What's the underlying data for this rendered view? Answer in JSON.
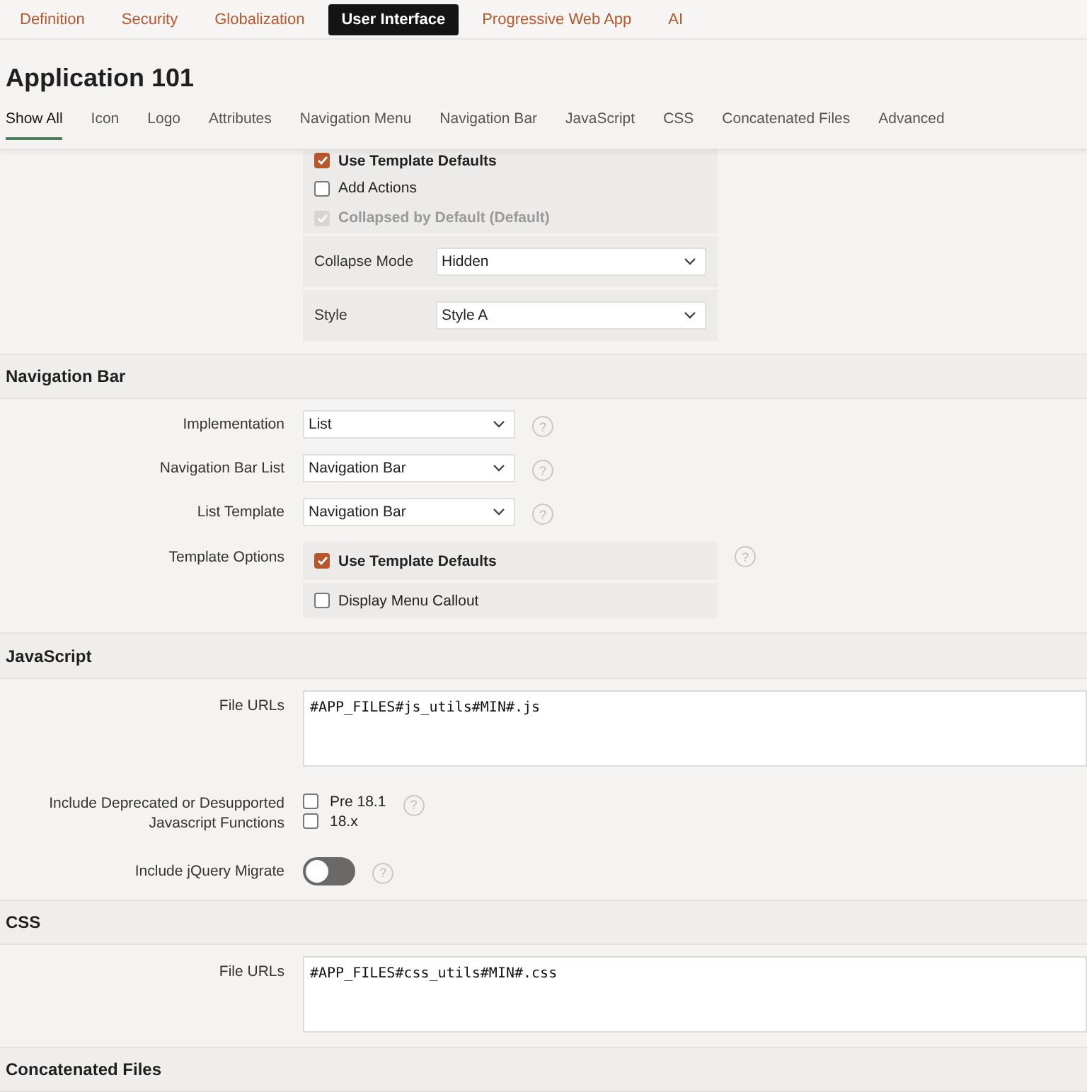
{
  "app_tabs": [
    {
      "label": "Definition",
      "selected": false
    },
    {
      "label": "Security",
      "selected": false
    },
    {
      "label": "Globalization",
      "selected": false
    },
    {
      "label": "User Interface",
      "selected": true
    },
    {
      "label": "Progressive Web App",
      "selected": false
    },
    {
      "label": "AI",
      "selected": false
    }
  ],
  "page_title": "Application 101",
  "section_tabs": [
    {
      "label": "Show All",
      "selected": true
    },
    {
      "label": "Icon",
      "selected": false
    },
    {
      "label": "Logo",
      "selected": false
    },
    {
      "label": "Attributes",
      "selected": false
    },
    {
      "label": "Navigation Menu",
      "selected": false
    },
    {
      "label": "Navigation Bar",
      "selected": false
    },
    {
      "label": "JavaScript",
      "selected": false
    },
    {
      "label": "CSS",
      "selected": false
    },
    {
      "label": "Concatenated Files",
      "selected": false
    },
    {
      "label": "Advanced",
      "selected": false
    }
  ],
  "navigation_menu_options": {
    "cut_option": {
      "label": "Use Template Defaults",
      "checked": true
    },
    "options": [
      {
        "label": "Add Actions",
        "checked": false,
        "disabled": false
      },
      {
        "label": "Collapsed by Default (Default)",
        "checked": true,
        "disabled": true
      }
    ],
    "fields": [
      {
        "label": "Collapse Mode",
        "value": "Hidden"
      },
      {
        "label": "Style",
        "value": "Style A"
      }
    ]
  },
  "sections": [
    {
      "title": "Navigation Bar",
      "rows": [
        {
          "kind": "select",
          "label": "Implementation",
          "value": "List",
          "help": "?"
        },
        {
          "kind": "select",
          "label": "Navigation Bar List",
          "value": "Navigation Bar",
          "help": "?"
        },
        {
          "kind": "select",
          "label": "List Template",
          "value": "Navigation Bar",
          "help": "?"
        },
        {
          "kind": "optionpanel",
          "label": "Template Options",
          "help": "?",
          "options": [
            {
              "label": "Use Template Defaults",
              "checked": true,
              "bold": true
            },
            {
              "label": "Display Menu Callout",
              "checked": false,
              "bold": false
            }
          ]
        }
      ]
    },
    {
      "title": "JavaScript",
      "rows": [
        {
          "kind": "textarea",
          "label": "File URLs",
          "value": "#APP_FILES#js_utils#MIN#.js"
        },
        {
          "kind": "checklist",
          "label": "Include Deprecated or Desupported Javascript Functions",
          "help": "?",
          "options": [
            {
              "label": "Pre 18.1",
              "checked": false
            },
            {
              "label": "18.x",
              "checked": false
            }
          ]
        },
        {
          "kind": "switch",
          "label": "Include jQuery Migrate",
          "on": false,
          "help": "?"
        }
      ]
    },
    {
      "title": "CSS",
      "rows": [
        {
          "kind": "textarea",
          "label": "File URLs",
          "value": "#APP_FILES#css_utils#MIN#.css"
        }
      ]
    }
  ],
  "cut_section_title": "Concatenated Files"
}
